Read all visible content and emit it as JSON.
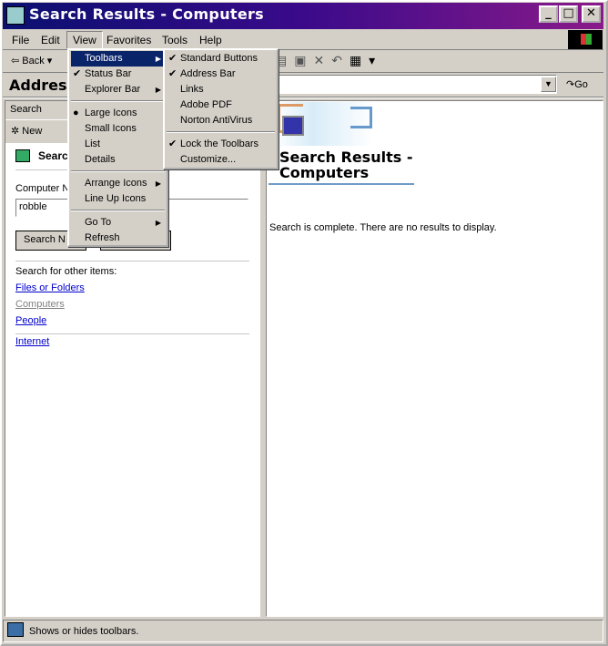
{
  "window": {
    "title": "Search Results - Computers",
    "minimize": "_",
    "maximize": "□",
    "close": "✕"
  },
  "menubar": {
    "items": [
      "File",
      "Edit",
      "View",
      "Favorites",
      "Tools",
      "Help"
    ]
  },
  "toolbar": {
    "back": "Back"
  },
  "address": {
    "label": "Address",
    "value": "",
    "go": "Go"
  },
  "view_menu": {
    "items": [
      {
        "label": "Toolbars",
        "submenu": true,
        "highlighted": true
      },
      {
        "label": "Status Bar",
        "checked": true
      },
      {
        "label": "Explorer Bar",
        "submenu": true
      },
      {
        "label": "Large Icons",
        "radio": true
      },
      {
        "label": "Small Icons"
      },
      {
        "label": "List"
      },
      {
        "label": "Details"
      },
      {
        "label": "Arrange Icons",
        "submenu": true
      },
      {
        "label": "Line Up Icons"
      },
      {
        "label": "Go To",
        "submenu": true
      },
      {
        "label": "Refresh"
      }
    ]
  },
  "toolbars_submenu": {
    "items": [
      {
        "label": "Standard Buttons",
        "checked": true
      },
      {
        "label": "Address Bar",
        "checked": true
      },
      {
        "label": "Links"
      },
      {
        "label": "Adobe PDF"
      },
      {
        "label": "Norton AntiVirus"
      },
      {
        "label": "Lock the Toolbars",
        "checked": true
      },
      {
        "label": "Customize..."
      }
    ]
  },
  "search_pane": {
    "header": "Search",
    "new_label": "New",
    "title": "Searc",
    "field_label": "Computer N",
    "field_value": "robble",
    "search_button": "Search N",
    "other_items_label": "Search for other items:",
    "links": [
      "Files or Folders",
      "Computers",
      "People",
      "Internet"
    ]
  },
  "results": {
    "heading_line1": "Search Results -",
    "heading_line2": "Computers",
    "message": "Search is complete. There are no results to display."
  },
  "status": {
    "text": "Shows or hides toolbars."
  }
}
